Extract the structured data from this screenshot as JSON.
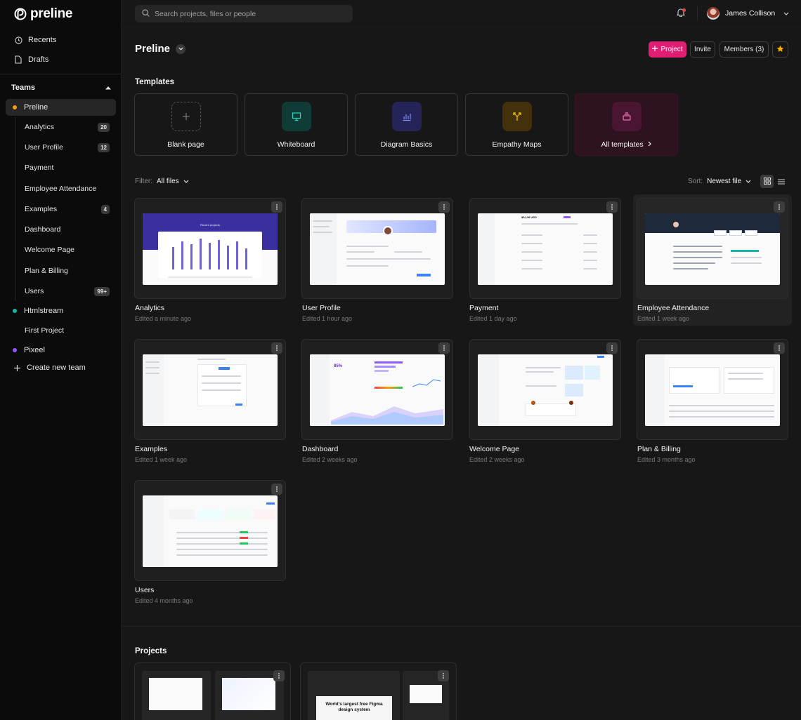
{
  "app": {
    "logo": "preline"
  },
  "sidebar": {
    "recents": "Recents",
    "drafts": "Drafts",
    "teams_label": "Teams",
    "teams": [
      {
        "name": "Preline",
        "color": "#f59e0b",
        "files": [
          {
            "label": "Analytics",
            "badge": "20"
          },
          {
            "label": "User Profile",
            "badge": "12"
          },
          {
            "label": "Payment",
            "badge": ""
          },
          {
            "label": "Employee Attendance",
            "badge": ""
          },
          {
            "label": "Examples",
            "badge": "4"
          },
          {
            "label": "Dashboard",
            "badge": ""
          },
          {
            "label": "Welcome Page",
            "badge": ""
          },
          {
            "label": "Plan & Billing",
            "badge": ""
          },
          {
            "label": "Users",
            "badge": "99+"
          }
        ]
      },
      {
        "name": "Htmlstream",
        "color": "#14b8a6",
        "files": [
          {
            "label": "First Project"
          }
        ]
      },
      {
        "name": "Pixeel",
        "color": "#8b5cf6",
        "files": []
      }
    ],
    "create_team": "Create new team"
  },
  "header": {
    "search_placeholder": "Search projects, files or people",
    "user_name": "James Collison"
  },
  "page": {
    "title": "Preline",
    "project_button": "Project",
    "invite_button": "Invite",
    "members_button": "Members (3)"
  },
  "templates": {
    "title": "Templates",
    "items": [
      {
        "label": "Blank page",
        "icon": "plus-icon"
      },
      {
        "label": "Whiteboard",
        "icon": "presentation-icon",
        "color": "#14b8a6"
      },
      {
        "label": "Diagram Basics",
        "icon": "chart-icon",
        "color": "#6366f1"
      },
      {
        "label": "Empathy Maps",
        "icon": "split-arrow-icon",
        "color": "#eab308"
      },
      {
        "label": "All templates",
        "icon": "stack-icon",
        "color": "#e11d74"
      }
    ]
  },
  "files": {
    "filter_label": "Filter:",
    "filter_value": "All files",
    "sort_label": "Sort:",
    "sort_value": "Newest file",
    "items": [
      {
        "name": "Analytics",
        "edited": "Edited a minute ago"
      },
      {
        "name": "User Profile",
        "edited": "Edited 1 hour ago"
      },
      {
        "name": "Payment",
        "edited": "Edited 1 day ago"
      },
      {
        "name": "Employee Attendance",
        "edited": "Edited 1 week ago"
      },
      {
        "name": "Examples",
        "edited": "Edited 1 week ago"
      },
      {
        "name": "Dashboard",
        "edited": "Edited 2 weeks ago"
      },
      {
        "name": "Welcome Page",
        "edited": "Edited 2 weeks ago"
      },
      {
        "name": "Plan & Billing",
        "edited": "Edited 3 months ago"
      },
      {
        "name": "Users",
        "edited": "Edited 4 months ago"
      }
    ]
  },
  "thumbnails": {
    "analytics_hero": "Recent projects",
    "payment_amount": "$9,128 USD",
    "dashboard_percent": "85%",
    "figma_banner": "World's largest free Figma design system"
  },
  "projects": {
    "title": "Projects"
  }
}
